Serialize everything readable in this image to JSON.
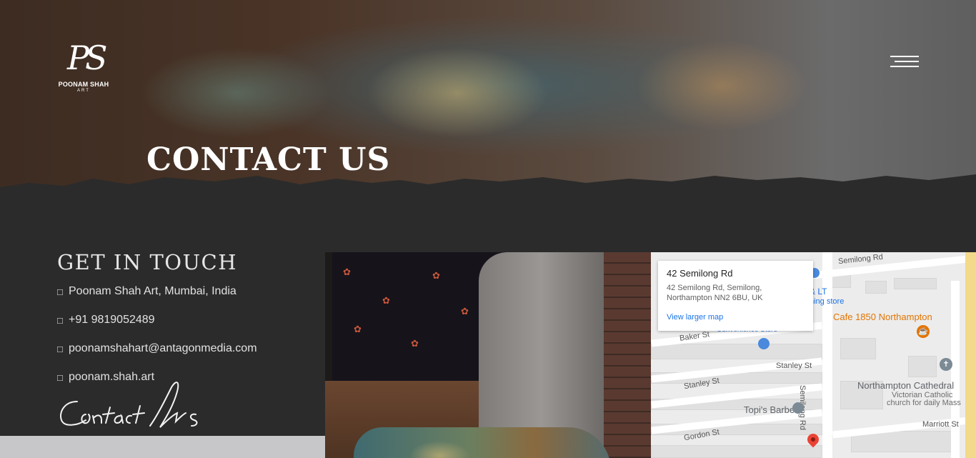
{
  "brand": {
    "monogram": "PS",
    "name": "POONAM SHAH",
    "sub": "ART"
  },
  "hero": {
    "title": "CONTACT US"
  },
  "contact": {
    "heading": "GET IN TOUCH",
    "items": [
      {
        "icon": "location-icon",
        "glyph": "□",
        "text": "Poonam Shah Art, Mumbai, India"
      },
      {
        "icon": "phone-icon",
        "glyph": "□",
        "text": "+91 9819052489"
      },
      {
        "icon": "email-icon",
        "glyph": "□",
        "text": "poonamshahart@antagonmedia.com"
      },
      {
        "icon": "instagram-icon",
        "glyph": "□",
        "text": "poonam.shah.art"
      }
    ],
    "signature": "Contact Us"
  },
  "map": {
    "card": {
      "title": "42 Semilong Rd",
      "address_line1": "42 Semilong Rd, Semilong,",
      "address_line2": "Northampton NN2 6BU, UK",
      "link": "View larger map"
    },
    "labels": {
      "semilong_rd_top": "Semilong Rd",
      "lt": "& LT",
      "ning_store": "ning store",
      "convenience": "Convenience Store",
      "baker_st": "Baker St",
      "stanley_st_right": "Stanley St",
      "stanley_st_left": "Stanley St",
      "semilong_rd_vertical": "Semilong Rd",
      "gordon_st": "Gordon St",
      "marriott_st": "Marriott St",
      "cafe": "Cafe 1850 Northampton",
      "cathedral": "Northampton Cathedral",
      "cathedral_desc1": "Victorian Catholic",
      "cathedral_desc2": "church for daily Mass",
      "barbers": "Topi's Barbers"
    },
    "colors": {
      "cafe": "#e37400",
      "poi_gray": "#5f6368",
      "pin_red": "#ea4335",
      "link_blue": "#1a73e8"
    }
  }
}
